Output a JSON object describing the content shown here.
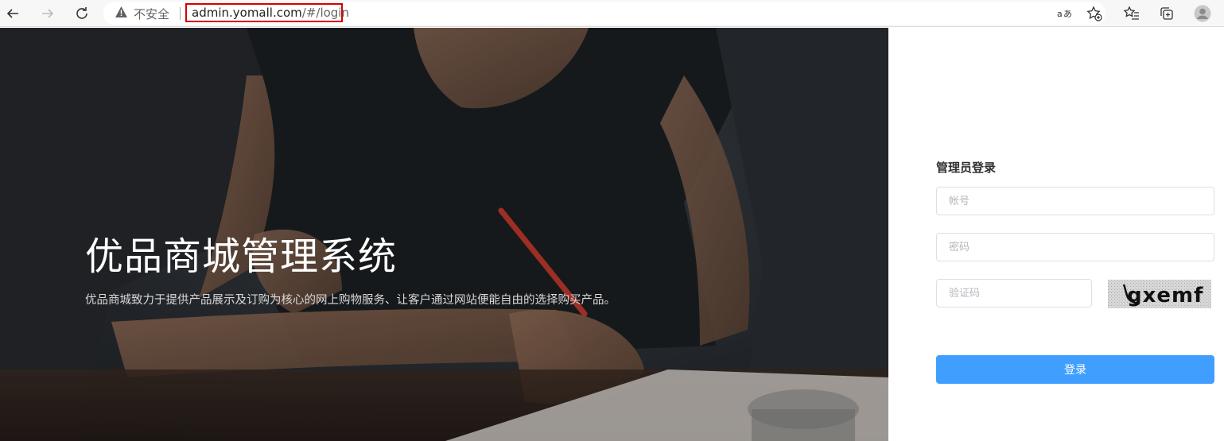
{
  "browser": {
    "security_label": "不安全",
    "url_host": "admin.yomall.com",
    "url_path": "/#/login",
    "icons": [
      "back-arrow-icon",
      "forward-arrow-icon",
      "reload-icon",
      "warning-icon",
      "read-aloud-icon",
      "add-favorite-icon",
      "favorites-icon",
      "collections-icon",
      "profile-icon"
    ]
  },
  "hero": {
    "title": "优品商城管理系统",
    "subtitle": "优品商城致力于提供产品展示及订购为核心的网上购物服务、让客户通过网站便能自由的选择购买产品。"
  },
  "login": {
    "title": "管理员登录",
    "account_placeholder": "帐号",
    "password_placeholder": "密码",
    "captcha_placeholder": "验证码",
    "captcha_text": "gxemf",
    "submit_label": "登录",
    "button_color": "#409eff"
  }
}
